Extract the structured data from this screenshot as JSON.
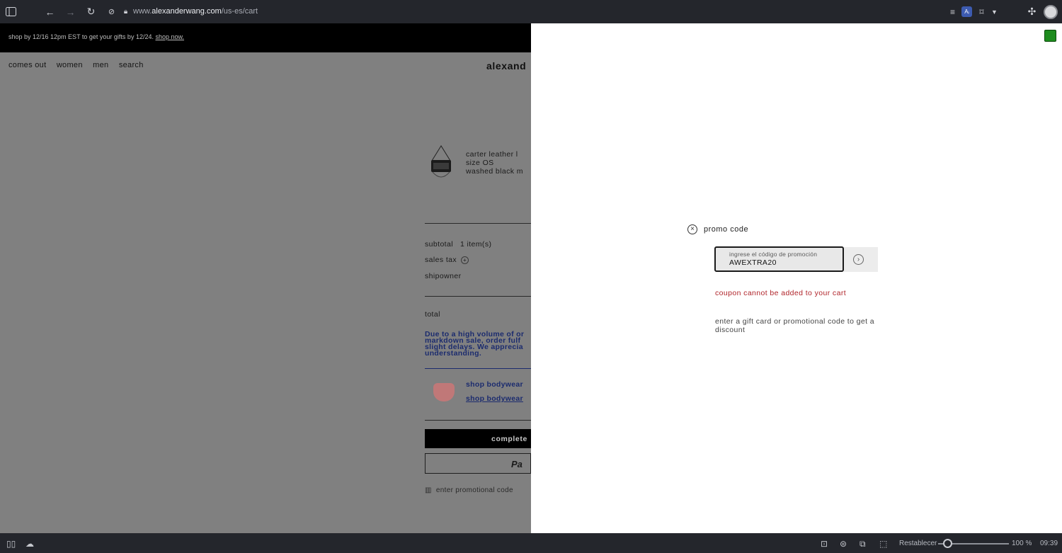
{
  "browser": {
    "url_prefix": "www.",
    "url_domain": "alexanderwang.com",
    "url_path": "/us-es/cart",
    "ai_badge": "Aᵢ"
  },
  "site": {
    "promo_bar_text": "shop by 12/16 12pm EST to get your gifts by 12/24.",
    "promo_bar_link": "shop now.",
    "nav": [
      "comes out",
      "women",
      "men",
      "search"
    ],
    "logo": "alexand",
    "product": {
      "name": "carter leather l",
      "size": "size OS",
      "color": "washed black m"
    },
    "summary": {
      "subtotal_label": "subtotal",
      "subtotal_count": "1 item(s)",
      "tax_label": "sales tax",
      "shipping_label": "shipowner",
      "total_label": "total"
    },
    "notice_lines": [
      "Due to a high volume of or",
      "markdown sale, order fulf",
      "slight delays. We apprecia",
      "understanding."
    ],
    "bodywear_title": "shop bodywear",
    "bodywear_link": "shop bodywear",
    "checkout_label": "complete",
    "paypal_label": "Pa",
    "enter_promo_label": "enter promotional code"
  },
  "modal": {
    "title": "promo code",
    "input_label": "ingrese el código de promoción",
    "input_value": "AWEXTRA20",
    "error": "coupon cannot be added to your cart",
    "help": "enter a gift card or promotional code to get a discount"
  },
  "statusbar": {
    "reset_label": "Restablecer",
    "zoom": "100 %",
    "zoom_level": 0.13,
    "time": "09:39"
  }
}
